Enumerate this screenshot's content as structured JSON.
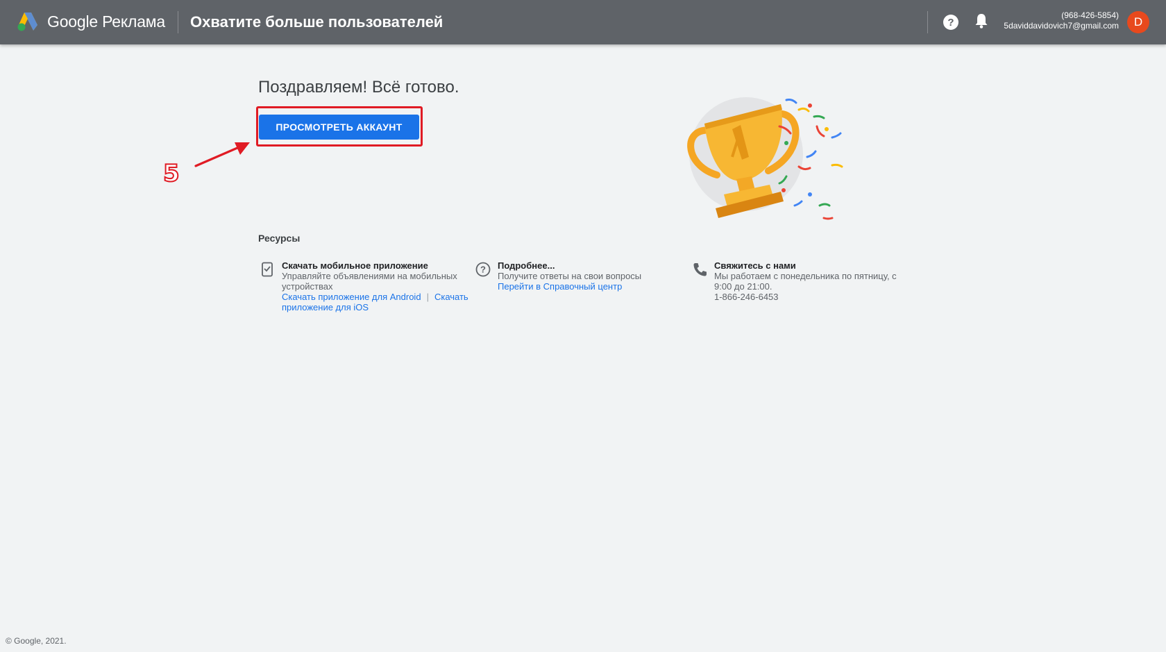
{
  "header": {
    "brand": "Google Реклама",
    "title": "Охватите больше пользователей",
    "phone": "(968-426-5854)",
    "email": "5daviddavidovich7@gmail.com",
    "avatar_letter": "D",
    "avatar_color": "#e8491d",
    "bar_color": "#5f6368"
  },
  "main": {
    "heading": "Поздравляем! Всё готово.",
    "view_account_button": "ПРОСМОТРЕТЬ АККАУНТ",
    "step_number": "5",
    "accent_color": "#1a73e8",
    "annotation_color": "#e01b24"
  },
  "resources": {
    "title": "Ресурсы",
    "items": [
      {
        "icon": "mobile-app-icon",
        "title": "Скачать мобильное приложение",
        "description": "Управляйте объявлениями на мобильных устройствах",
        "link_android": "Скачать приложение для Android",
        "separator": "|",
        "link_ios": "Скачать приложение для iOS"
      },
      {
        "icon": "help-circle-icon",
        "title": "Подробнее...",
        "description": "Получите ответы на свои вопросы",
        "link": "Перейти в Справочный центр"
      },
      {
        "icon": "phone-icon",
        "title": "Свяжитесь с нами",
        "description": "Мы работаем с понедельника по пятницу, с 9:00 до 21:00.",
        "phone": "1-866-246-6453"
      }
    ]
  },
  "footer": {
    "copyright": "© Google, 2021."
  }
}
